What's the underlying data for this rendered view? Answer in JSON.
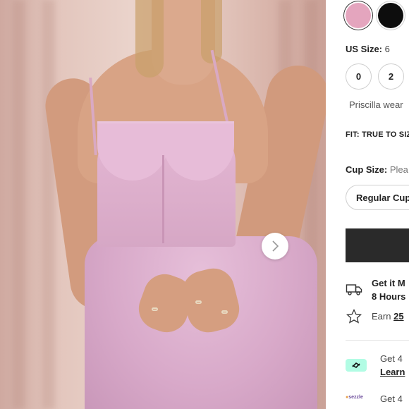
{
  "product": {
    "color_swatches": [
      {
        "name": "pink",
        "color": "#e4a5be",
        "selected": true
      },
      {
        "name": "black",
        "color": "#0d0d0d",
        "selected": false
      }
    ],
    "size_label": "US Size:",
    "size_value": "6",
    "size_options": [
      "0",
      "2"
    ],
    "model_note": "Priscilla wear",
    "fit_note": "FIT: TRUE TO SIZ",
    "cup_label": "Cup Size:",
    "cup_hint": "Plea",
    "cup_selected": "Regular Cup",
    "next_icon": "chevron-right-icon"
  },
  "delivery": {
    "line1": "Get it M",
    "line2": "8 Hours",
    "icon": "truck-icon"
  },
  "rewards": {
    "prefix": "Earn",
    "points": "25",
    "icon": "star-icon"
  },
  "payments": {
    "afterpay_text": "Get 4",
    "afterpay_link": "Learn",
    "sezzle_logo": "sezzle",
    "sezzle_text": "Get 4"
  },
  "colors": {
    "accent_dark": "#2a2a2a",
    "afterpay": "#b2fce4",
    "dress_pink": "#e4a5be"
  }
}
